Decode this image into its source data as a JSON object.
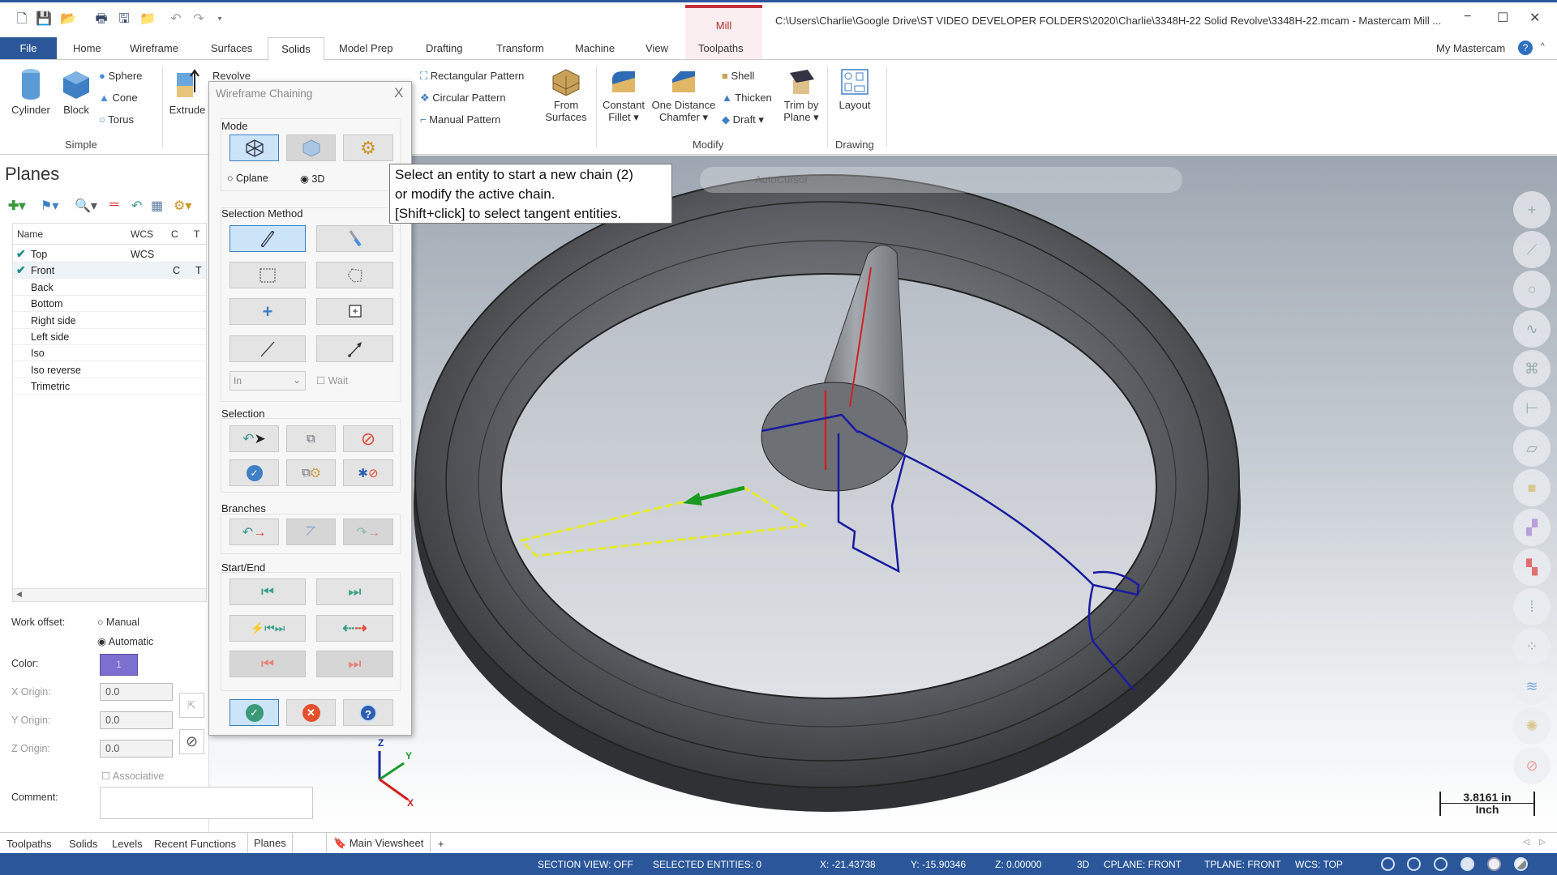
{
  "titlebar": {
    "title": "C:\\Users\\Charlie\\Google Drive\\ST VIDEO DEVELOPER FOLDERS\\2020\\Charlie\\3348H-22 Solid Revolve\\3348H-22.mcam - Mastercam Mill ...",
    "context_tab": "Mill",
    "minimize": "−",
    "maximize": "☐",
    "close": "✕"
  },
  "tabs": {
    "file": "File",
    "items": [
      "Home",
      "Wireframe",
      "Surfaces",
      "Solids",
      "Model Prep",
      "Drafting",
      "Transform",
      "Machine",
      "View",
      "Toolpaths"
    ],
    "active": "Solids",
    "my_mastercam": "My Mastercam"
  },
  "ribbon": {
    "simple": {
      "label": "Simple",
      "cylinder": "Cylinder",
      "block": "Block",
      "sphere": "Sphere",
      "cone": "Cone",
      "torus": "Torus"
    },
    "extrude": "Extrude",
    "revolve": "Revolve",
    "rectangular_pattern": "Rectangular Pattern",
    "circular_pattern": "Circular Pattern",
    "manual_pattern": "Manual Pattern",
    "from_surfaces": [
      "From",
      "Surfaces"
    ],
    "modify": {
      "label": "Modify",
      "constant_fillet": [
        "Constant",
        "Fillet ▾"
      ],
      "chamfer": [
        "One Distance",
        "Chamfer ▾"
      ],
      "shell": "Shell",
      "thicken": "Thicken",
      "draft": "Draft ▾",
      "trim": [
        "Trim by",
        "Plane ▾"
      ]
    },
    "drawing": {
      "label": "Drawing",
      "layout": "Layout"
    }
  },
  "planes": {
    "title": "Planes",
    "columns": [
      "Name",
      "WCS",
      "C",
      "T"
    ],
    "rows": [
      {
        "name": "Top",
        "wcs": "WCS",
        "c": "",
        "t": "",
        "checked": true
      },
      {
        "name": "Front",
        "wcs": "",
        "c": "C",
        "t": "T",
        "checked": true
      },
      {
        "name": "Back"
      },
      {
        "name": "Bottom"
      },
      {
        "name": "Right side"
      },
      {
        "name": "Left side"
      },
      {
        "name": "Iso"
      },
      {
        "name": "Iso reverse"
      },
      {
        "name": "Trimetric"
      }
    ],
    "work_offset_label": "Work offset:",
    "manual": "Manual",
    "automatic": "Automatic",
    "work_offset_selected": "Automatic",
    "color_label": "Color:",
    "color_value": "1",
    "color_hex": "#7b6fcf",
    "x_origin_label": "X Origin:",
    "x_origin": "0.0",
    "y_origin_label": "Y Origin:",
    "y_origin": "0.0",
    "z_origin_label": "Z Origin:",
    "z_origin": "0.0",
    "associative": "Associative",
    "comment_label": "Comment:",
    "comment": ""
  },
  "dialog": {
    "title": "Wireframe Chaining",
    "close": "X",
    "mode_label": "Mode",
    "cplane": "Cplane",
    "three_d": "3D",
    "mode_selected": "3D",
    "selection_method_label": "Selection Method",
    "in_value": "In",
    "wait": "Wait",
    "selection_label": "Selection",
    "branches_label": "Branches",
    "start_end_label": "Start/End"
  },
  "tooltip": {
    "lines": [
      "Select an entity to start a new chain (2)",
      "or modify the active chain.",
      "[Shift+click] to select tangent entities."
    ]
  },
  "viewport": {
    "toolbar_text": "AutoCursor",
    "scale_value": "3.8161 in",
    "scale_unit": "Inch",
    "axes": {
      "x": "X",
      "y": "Y",
      "z": "Z"
    }
  },
  "bottom_tabs": {
    "items": [
      "Toolpaths",
      "Solids",
      "Levels",
      "Recent Functions",
      "Planes"
    ],
    "active": "Planes",
    "viewsheet": "Main Viewsheet",
    "add": "+"
  },
  "status": {
    "section_view": "SECTION VIEW: OFF",
    "selected": "SELECTED ENTITIES: 0",
    "x": "X:  -21.43738",
    "y": "Y:  -15.90346",
    "z": "Z:  0.00000",
    "mode": "3D",
    "cplane": "CPLANE: FRONT",
    "tplane": "TPLANE: FRONT",
    "wcs": "WCS: TOP"
  },
  "colors": {
    "accent": "#2b579a",
    "chain_yellow": "#e6ea2a",
    "geometry_blue": "#1a1a9a",
    "axis_red": "#d02020"
  }
}
